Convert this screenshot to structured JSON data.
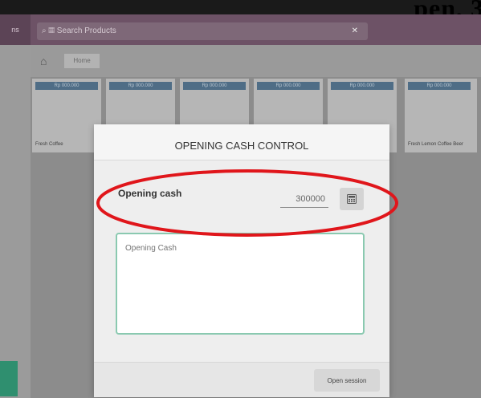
{
  "top_strip": {
    "cropped_text": "pen, 3"
  },
  "navbar": {
    "left_label": "ns",
    "search": {
      "placeholder": "Search Products",
      "clear_icon": "close-icon"
    }
  },
  "breadcrumb": {
    "home_icon": "home-icon",
    "home_label": "Home"
  },
  "products": [
    {
      "tag": "Rp 000.000",
      "name": "Fresh Coffee"
    },
    {
      "tag": "Rp 000.000",
      "name": ""
    },
    {
      "tag": "Rp 000.000",
      "name": ""
    },
    {
      "tag": "Rp 000.000",
      "name": ""
    },
    {
      "tag": "Rp 000.000",
      "name": ""
    },
    {
      "tag": "Rp 000.000",
      "name": "Fresh Lemon Coffee Beer"
    }
  ],
  "modal": {
    "title": "OPENING CASH CONTROL",
    "opening_cash_label": "Opening cash",
    "opening_cash_value": "300000",
    "calculator_icon": "calculator-icon",
    "notes_placeholder": "Opening Cash",
    "open_button_label": "Open session"
  },
  "annotation": {
    "color": "#e0161b"
  },
  "colors": {
    "navbar": "#6d5266",
    "accent_green": "#8ac9b0"
  }
}
